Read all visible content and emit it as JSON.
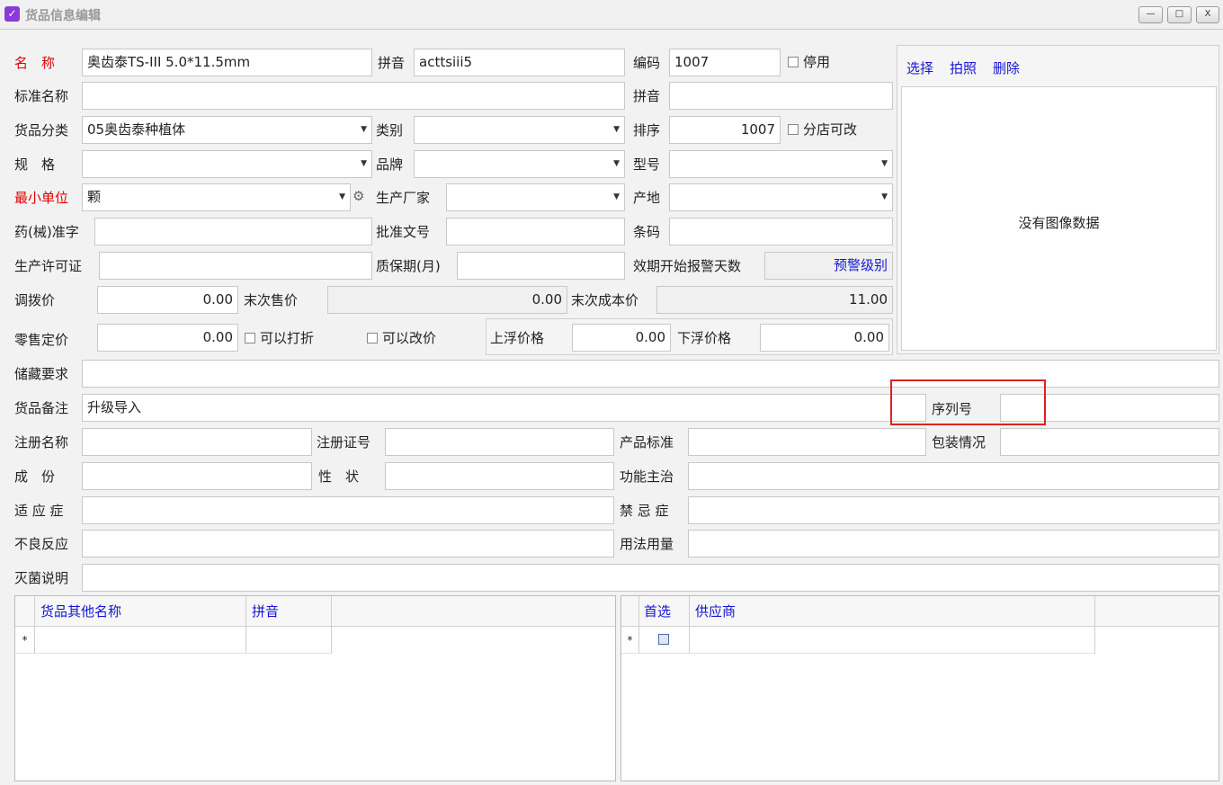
{
  "window": {
    "title": "货品信息编辑",
    "min": "—",
    "max": "□",
    "close": "X"
  },
  "form": {
    "name_label": "名　称",
    "name_value": "奥齿泰TS-III 5.0*11.5mm",
    "pinyin_label": "拼音",
    "pinyin_value": "acttsiii5",
    "code_label": "编码",
    "code_value": "1007",
    "disabled_label": "停用",
    "std_name_label": "标准名称",
    "std_name_value": "",
    "std_pinyin_label": "拼音",
    "std_pinyin_value": "",
    "category_label": "货品分类",
    "category_value": "05奥齿泰种植体",
    "type_label": "类别",
    "type_value": "",
    "sort_label": "排序",
    "sort_value": "1007",
    "branch_editable_label": "分店可改",
    "spec_label": "规　格",
    "brand_label": "品牌",
    "model_label": "型号",
    "min_unit_label": "最小单位",
    "min_unit_value": "颗",
    "manufacturer_label": "生产厂家",
    "origin_label": "产地",
    "drug_approval_label": "药(械)准字",
    "approval_doc_label": "批准文号",
    "barcode_label": "条码",
    "production_license_label": "生产许可证",
    "shelf_life_label": "质保期(月)",
    "expiry_warning_label": "效期开始报警天数",
    "warning_level_link": "预警级别",
    "transfer_price_label": "调拨价",
    "transfer_price_value": "0.00",
    "last_sale_label": "末次售价",
    "last_sale_value": "0.00",
    "last_cost_label": "末次成本价",
    "last_cost_value": "11.00",
    "retail_price_label": "零售定价",
    "retail_price_value": "0.00",
    "discount_label": "可以打折",
    "price_change_label": "可以改价",
    "float_up_label": "上浮价格",
    "float_up_value": "0.00",
    "float_down_label": "下浮价格",
    "float_down_value": "0.00",
    "storage_label": "储藏要求",
    "remark_label": "货品备注",
    "remark_value": "升级导入",
    "serial_label": "序列号",
    "reg_name_label": "注册名称",
    "reg_cert_label": "注册证号",
    "product_std_label": "产品标准",
    "packaging_label": "包装情况",
    "ingredient_label": "成　份",
    "property_label": "性　状",
    "function_label": "功能主治",
    "indication_label": "适 应 症",
    "contraindication_label": "禁 忌 症",
    "adverse_label": "不良反应",
    "usage_label": "用法用量",
    "sterilize_label": "灭菌说明"
  },
  "image": {
    "select": "选择",
    "photo": "拍照",
    "delete": "删除",
    "empty": "没有图像数据"
  },
  "alias_grid": {
    "col1": "货品其他名称",
    "col2": "拼音",
    "new_row_marker": "*"
  },
  "supplier_grid": {
    "col1": "首选",
    "col2": "供应商",
    "new_row_marker": "*"
  },
  "colors": {
    "required": "#e00000",
    "link": "#1515d6",
    "highlight": "#e02020"
  }
}
